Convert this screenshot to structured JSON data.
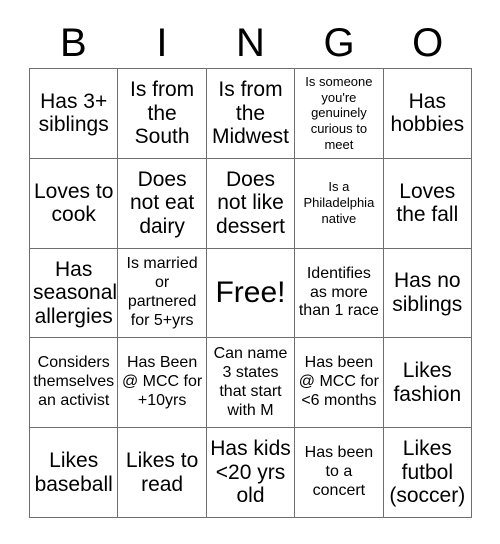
{
  "card": {
    "title": "BINGO",
    "header_letters": [
      "B",
      "I",
      "N",
      "G",
      "O"
    ],
    "free_space_label": "Free!",
    "colors": {
      "text": "#000000",
      "grid_line": "#6f6f6f",
      "background": "#ffffff"
    },
    "grid_size": "5x5",
    "rows": [
      {
        "cells": [
          {
            "text": "Has 3+ siblings",
            "size": "md"
          },
          {
            "text": "Is from the South",
            "size": "md"
          },
          {
            "text": "Is from the Midwest",
            "size": "md"
          },
          {
            "text": "Is someone you're genuinely curious to meet",
            "size": "xs"
          },
          {
            "text": "Has hobbies",
            "size": "md"
          }
        ]
      },
      {
        "cells": [
          {
            "text": "Loves to cook",
            "size": "md"
          },
          {
            "text": "Does not eat dairy",
            "size": "md"
          },
          {
            "text": "Does not like dessert",
            "size": "md"
          },
          {
            "text": "Is a Philadelphia native",
            "size": "xs"
          },
          {
            "text": "Loves the fall",
            "size": "md"
          }
        ]
      },
      {
        "cells": [
          {
            "text": "Has seasonal allergies",
            "size": "md"
          },
          {
            "text": "Is married or partnered for 5+yrs",
            "size": "sm"
          },
          {
            "text": "Free!",
            "size": "lg"
          },
          {
            "text": "Identifies as more than 1 race",
            "size": "sm"
          },
          {
            "text": "Has no siblings",
            "size": "md"
          }
        ]
      },
      {
        "cells": [
          {
            "text": "Considers themselves an activist",
            "size": "sm"
          },
          {
            "text": "Has Been @ MCC for +10yrs",
            "size": "sm"
          },
          {
            "text": "Can name 3 states that start with M",
            "size": "sm"
          },
          {
            "text": "Has been @ MCC for <6 months",
            "size": "sm"
          },
          {
            "text": "Likes fashion",
            "size": "md"
          }
        ]
      },
      {
        "cells": [
          {
            "text": "Likes baseball",
            "size": "md"
          },
          {
            "text": "Likes to read",
            "size": "md"
          },
          {
            "text": "Has kids <20 yrs old",
            "size": "md"
          },
          {
            "text": "Has been to a concert",
            "size": "sm"
          },
          {
            "text": "Likes futbol (soccer)",
            "size": "md"
          }
        ]
      }
    ]
  }
}
